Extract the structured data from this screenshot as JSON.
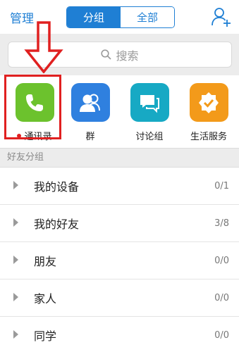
{
  "header": {
    "manage_label": "管理",
    "tabs": [
      {
        "label": "分组",
        "active": true
      },
      {
        "label": "全部",
        "active": false
      }
    ],
    "add_contact_icon": "add-contact-icon"
  },
  "search": {
    "placeholder": "搜索",
    "icon": "search-icon"
  },
  "apps": [
    {
      "label": "通讯录",
      "icon": "phone-icon",
      "color": "#6cc22d",
      "has_dot": true
    },
    {
      "label": "群",
      "icon": "group-icon",
      "color": "#2f80df",
      "has_dot": false
    },
    {
      "label": "讨论组",
      "icon": "chat-icon",
      "color": "#17a9c4",
      "has_dot": false
    },
    {
      "label": "生活服务",
      "icon": "service-badge-icon",
      "color": "#f39a1a",
      "has_dot": false
    }
  ],
  "section_title": "好友分组",
  "groups": [
    {
      "name": "我的设备",
      "count": "0/1"
    },
    {
      "name": "我的好友",
      "count": "3/8"
    },
    {
      "name": "朋友",
      "count": "0/0"
    },
    {
      "name": "家人",
      "count": "0/0"
    },
    {
      "name": "同学",
      "count": "0/0"
    }
  ],
  "colors": {
    "accent": "#1f7fd4",
    "highlight": "#e02020",
    "section_bg": "#ececec"
  }
}
